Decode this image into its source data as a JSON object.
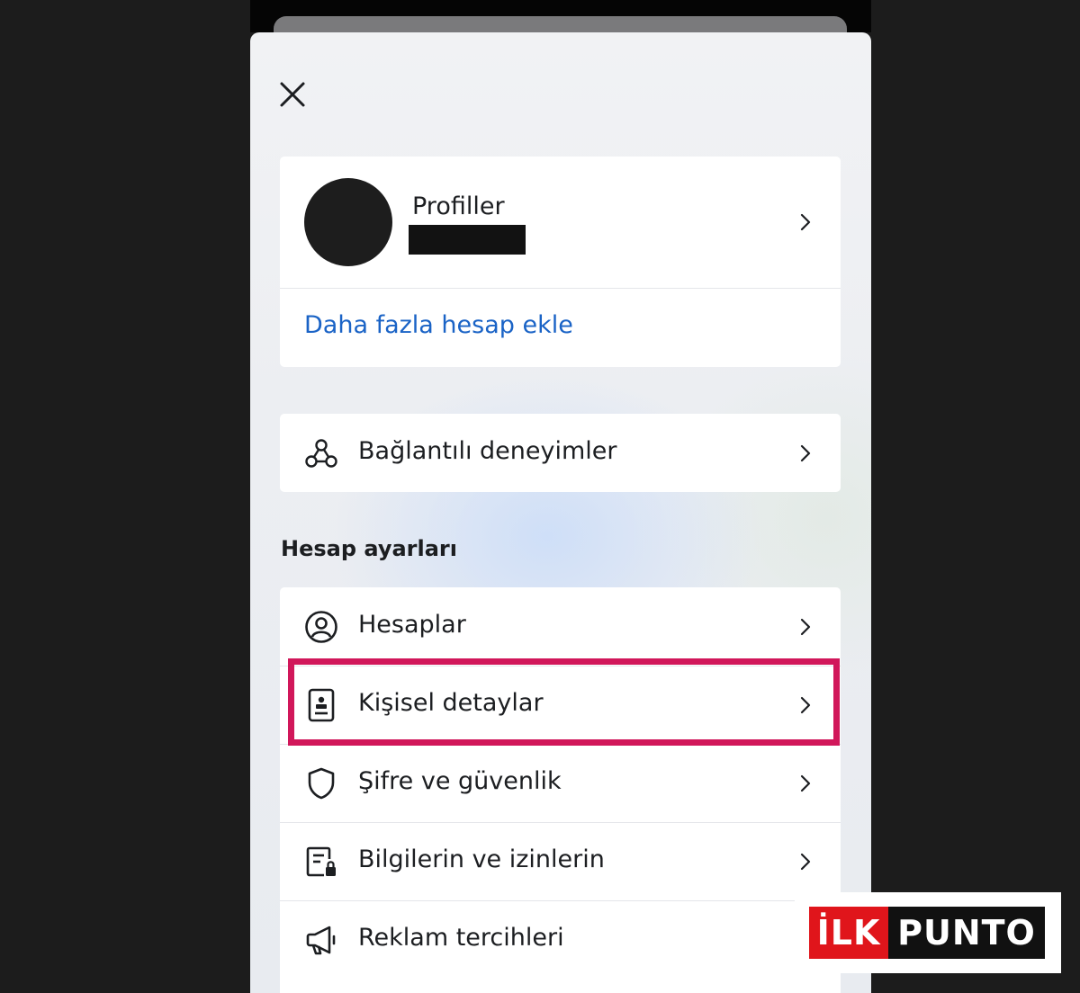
{
  "sheet": {
    "close_icon": "close-icon"
  },
  "profile": {
    "title": "Profiller",
    "add_account_label": "Daha fazla hesap ekle"
  },
  "connected": {
    "label": "Bağlantılı deneyimler",
    "icon": "connected-nodes-icon"
  },
  "account_settings": {
    "section_title": "Hesap ayarları",
    "items": [
      {
        "label": "Hesaplar",
        "icon": "account-circle-icon"
      },
      {
        "label": "Kişisel detaylar",
        "icon": "id-card-icon",
        "highlighted": true
      },
      {
        "label": "Şifre ve güvenlik",
        "icon": "shield-icon"
      },
      {
        "label": "Bilgilerin ve izinlerin",
        "icon": "document-lock-icon"
      },
      {
        "label": "Reklam tercihleri",
        "icon": "megaphone-icon"
      }
    ]
  },
  "colors": {
    "link": "#1a63c6",
    "highlight": "#d1175a",
    "text": "#1c1e21"
  },
  "watermark": {
    "part1": "İLK",
    "part2": "PUNTO"
  }
}
